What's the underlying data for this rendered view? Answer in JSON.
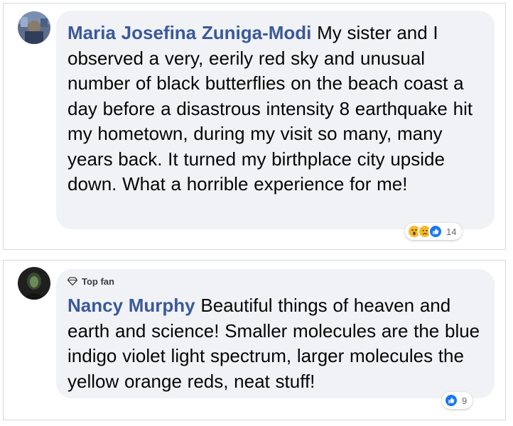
{
  "comments": [
    {
      "author": "Maria Josefina Zuniga-Modi",
      "text": " My sister and I observed a very, eerily red sky and unusual number of black butterflies on the beach coast a day before a disastrous intensity 8 earthquake hit my hometown, during my visit so many, many years back. It turned my birthplace city upside down. What a horrible experience for me!",
      "reactions": {
        "icons": [
          "wow-icon",
          "sad-icon",
          "like-icon"
        ],
        "count": "14"
      }
    },
    {
      "badge": "Top fan",
      "author": "Nancy Murphy",
      "text": " Beautiful things of heaven and earth and science! Smaller molecules are the blue indigo violet light spectrum, larger molecules the yellow orange reds, neat stuff!",
      "reactions": {
        "icons": [
          "like-icon"
        ],
        "count": "9"
      }
    }
  ],
  "colors": {
    "author_link": "#3b5998",
    "bubble_bg": "#f0f2f5",
    "like_blue": "#1877f2",
    "reaction_yellow": "#f7b928"
  }
}
